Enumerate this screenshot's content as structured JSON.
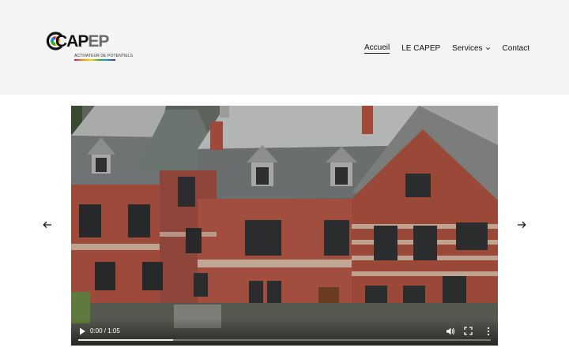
{
  "brand": {
    "name": "CAPEP",
    "name_main": "CAP",
    "name_end": "EP",
    "tagline": "ACTIVATEUR DE POTENTIELS",
    "colors": [
      "#e6007e",
      "#f39200",
      "#ffd500",
      "#3aaa35",
      "#009fe3",
      "#662483"
    ]
  },
  "nav": {
    "items": [
      {
        "label": "Accueil",
        "active": true
      },
      {
        "label": "LE CAPEP",
        "active": false
      },
      {
        "label": "Services",
        "active": false,
        "has_dropdown": true
      },
      {
        "label": "Contact",
        "active": false
      }
    ]
  },
  "carousel": {
    "prev_icon": "arrow-left-icon",
    "next_icon": "arrow-right-icon"
  },
  "video": {
    "current_time": "0:00 / 1:05",
    "progress": 0.0,
    "buffered": 0.23,
    "icons": [
      "play-icon",
      "volume-icon",
      "fullscreen-icon",
      "more-options-icon"
    ]
  }
}
